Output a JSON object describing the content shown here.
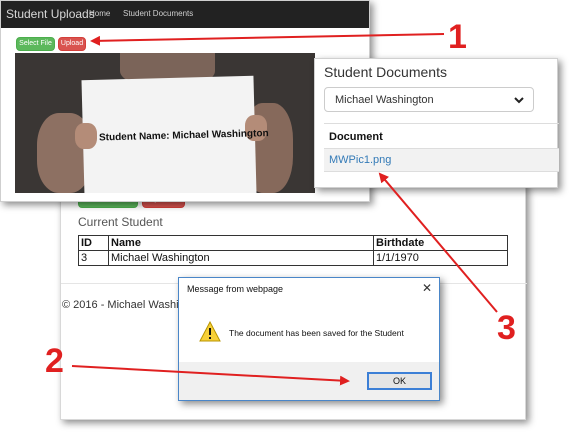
{
  "main_window": {
    "select_file_label": "Select File",
    "upload_label": "Upload",
    "current_student_label": "Current Student",
    "table": {
      "headers": [
        "ID",
        "Name",
        "Birthdate"
      ],
      "rows": [
        [
          "3",
          "Michael Washington",
          "1/1/1970"
        ]
      ]
    },
    "footer_text": "© 2016 - Michael Washi"
  },
  "upload_window": {
    "brand": "Student Uploads",
    "nav": [
      "Home",
      "Student Documents"
    ],
    "select_file_label": "Select File",
    "upload_label": "Upload",
    "photo_text": "Student Name: Michael Washington"
  },
  "docs_window": {
    "title": "Student Documents",
    "selected_student": "Michael Washington",
    "column_header": "Document",
    "documents": [
      "MWPic1.png"
    ]
  },
  "dialog": {
    "title": "Message from webpage",
    "message": "The document has been saved for the Student",
    "ok_label": "OK",
    "close_glyph": "✕"
  },
  "callouts": [
    "1",
    "2",
    "3"
  ],
  "colors": {
    "callout": "#e02020",
    "btn_green": "#5cb85c",
    "btn_red": "#d9534f",
    "link": "#337ab7",
    "navbar": "#222222"
  }
}
